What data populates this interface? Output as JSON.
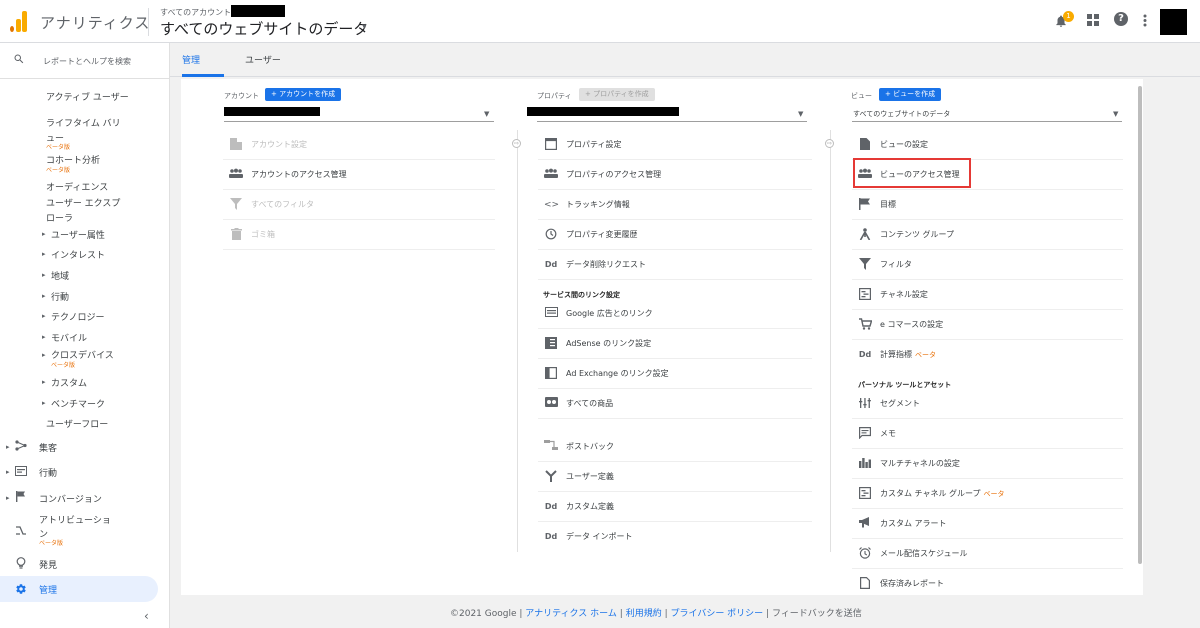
{
  "header": {
    "app_title": "アナリティクス",
    "account_label": "すべてのアカウント",
    "view_title": "すべてのウェブサイトのデータ",
    "caret": "▾",
    "notification_count": "1",
    "help_glyph": "?"
  },
  "sidebar": {
    "search_placeholder": "レポートとヘルプを検索",
    "audience_items": [
      {
        "label": "アクティブ ユーザー"
      },
      {
        "label": "ライフタイム バリ"
      },
      {
        "label": "ュー"
      },
      {
        "label": "ベータ版"
      },
      {
        "label": "コホート分析"
      },
      {
        "label": "ベータ版"
      },
      {
        "label": "オーディエンス"
      },
      {
        "label": "ユーザー エクスプ"
      },
      {
        "label": "ローラ"
      },
      {
        "label": "ユーザー属性"
      },
      {
        "label": "インタレスト"
      },
      {
        "label": "地域"
      },
      {
        "label": "行動"
      },
      {
        "label": "テクノロジー"
      },
      {
        "label": "モバイル"
      },
      {
        "label": "クロスデバイス"
      },
      {
        "label": "ベータ版"
      },
      {
        "label": "カスタム"
      },
      {
        "label": "ベンチマーク"
      },
      {
        "label": "ユーザーフロー"
      }
    ],
    "sections": [
      {
        "label": "集客"
      },
      {
        "label": "行動"
      },
      {
        "label": "コンバージョン"
      },
      {
        "label": "アトリビューショ"
      },
      {
        "label": "ン"
      },
      {
        "label": "ベータ版"
      },
      {
        "label": "発見"
      },
      {
        "label": "管理"
      }
    ]
  },
  "tabs": {
    "admin": "管理",
    "user": "ユーザー"
  },
  "account_col": {
    "label": "アカウント",
    "create_button": "+ アカウントを作成",
    "rows": [
      {
        "label": "アカウント設定"
      },
      {
        "label": "アカウントのアクセス管理"
      },
      {
        "label": "すべてのフィルタ"
      },
      {
        "label": "ゴミ箱"
      }
    ]
  },
  "property_col": {
    "label": "プロパティ",
    "create_button": "+ プロパティを作成",
    "rows": [
      {
        "label": "プロパティ設定"
      },
      {
        "label": "プロパティのアクセス管理"
      },
      {
        "label": "トラッキング情報"
      },
      {
        "label": "プロパティ変更履歴"
      },
      {
        "label": "データ削除リクエスト"
      }
    ],
    "link_section": "サービス間のリンク設定",
    "link_rows": [
      {
        "label": "Google 広告とのリンク"
      },
      {
        "label": "AdSense のリンク設定"
      },
      {
        "label": "Ad Exchange のリンク設定"
      },
      {
        "label": "すべての商品"
      },
      {
        "label": "ポストバック"
      },
      {
        "label": "ユーザー定義"
      },
      {
        "label": "カスタム定義"
      },
      {
        "label": "データ インポート"
      }
    ]
  },
  "view_col": {
    "label": "ビュー",
    "create_button": "+ ビューを作成",
    "selected_view": "すべてのウェブサイトのデータ",
    "rows": [
      {
        "label": "ビューの設定"
      },
      {
        "label": "ビューのアクセス管理"
      },
      {
        "label": "目標"
      },
      {
        "label": "コンテンツ グループ"
      },
      {
        "label": "フィルタ"
      },
      {
        "label": "チャネル設定"
      },
      {
        "label": "e コマースの設定"
      },
      {
        "label": "計算指標",
        "beta": "ベータ"
      }
    ],
    "personal_section": "パーソナル ツールとアセット",
    "personal_rows": [
      {
        "label": "セグメント"
      },
      {
        "label": "メモ"
      },
      {
        "label": "マルチチャネルの設定"
      },
      {
        "label": "カスタム チャネル グループ",
        "beta": "ベータ"
      },
      {
        "label": "カスタム アラート"
      },
      {
        "label": "メール配信スケジュール"
      },
      {
        "label": "保存済みレポート"
      }
    ]
  },
  "footer": {
    "copyright": "©2021 Google |",
    "home": "アナリティクス ホーム",
    "sep1": "|",
    "terms": "利用規約",
    "sep2": "|",
    "privacy": "プライバシー ポリシー",
    "sep3": "|",
    "feedback": "フィードバックを送信"
  }
}
